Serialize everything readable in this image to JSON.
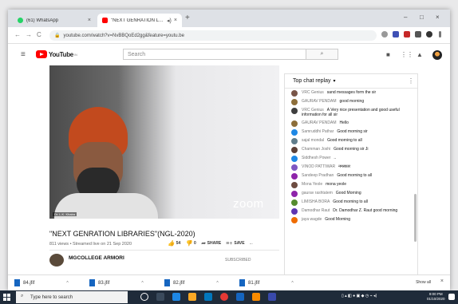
{
  "browser": {
    "tabs": [
      {
        "label": "(61) WhatsApp",
        "favicon_color": "#25d366"
      },
      {
        "label": "\"NEXT GENRATION LIBRARI",
        "favicon_color": "#ff0000"
      }
    ],
    "new_tab": "+",
    "controls": {
      "minimize": "–",
      "maximize": "□",
      "close": "×"
    },
    "back": "←",
    "forward": "→",
    "reload": "C",
    "url": "youtube.com/watch?v=NvBBQoEd2gg&feature=youtu.be"
  },
  "youtube": {
    "logo_text": "YouTube",
    "logo_region": "IN",
    "search_placeholder": "Search",
    "search_icon": "⌕"
  },
  "video": {
    "presenter_caption": "Dr. L.K. Khaira",
    "watermark": "zoom",
    "title": "\"NEXT GENRATION LIBRARIES\"(NGL-2020)",
    "meta": "811 views • Streamed live on 21 Sep 2020",
    "likes": "54",
    "dislikes": "0",
    "share_label": "SHARE",
    "save_label": "SAVE",
    "more": "...",
    "channel_name": "MGCOLLEGE ARMORI",
    "subscribe_label": "SUBSCRIBED"
  },
  "chat": {
    "header": "Top chat replay",
    "header_caret": "▾",
    "more_icon": "⋮",
    "messages": [
      {
        "author": "VRC Genius",
        "text": "sand messages form the sir",
        "color": "#795548"
      },
      {
        "author": "GAURAV PENDAM",
        "text": "good morning",
        "color": "#8d6e3a"
      },
      {
        "author": "VRC Genius",
        "text": "A Very nice presentation and good useful information for all sir",
        "color": "#3e3e3e"
      },
      {
        "author": "GAURAV PENDAM",
        "text": "Hello",
        "color": "#8d6e3a"
      },
      {
        "author": "Samruddhi Pathar",
        "text": "Good morning sir",
        "color": "#1e88e5"
      },
      {
        "author": "sajal mondal",
        "text": "Good morning to all",
        "color": "#607d8b"
      },
      {
        "author": "Chamman Joshi",
        "text": "Good morning sir Ji",
        "color": "#5d4037"
      },
      {
        "author": "Siddhesh Power",
        "text": "..",
        "color": "#1e88e5"
      },
      {
        "author": "VINOD PATTIWAR",
        "text": "नमस्कार",
        "color": "#7e57c2"
      },
      {
        "author": "Sandeep Pradhan",
        "text": "Good morning to all",
        "color": "#8e24aa"
      },
      {
        "author": "Mona Yeole",
        "text": "mona yeole",
        "color": "#6d4c41"
      },
      {
        "author": "gaurav rashtatem",
        "text": "Good Morning",
        "color": "#8e24aa"
      },
      {
        "author": "LIMISHA BORA",
        "text": "Good morning to all",
        "color": "#558b2f"
      },
      {
        "author": "Damodhar Raut",
        "text": "Dr. Damodhar Z. Raut good morning",
        "color": "#5e35b1"
      },
      {
        "author": "jaya wagde",
        "text": "Good Morning",
        "color": "#ef6c00"
      }
    ]
  },
  "downloads": {
    "items": [
      "84.jfif",
      "83.jfif",
      "82.jfif",
      "81.jfif"
    ],
    "caret": "^",
    "show_all": "Show all",
    "close": "×"
  },
  "taskbar": {
    "search_placeholder": "Type here to search",
    "time": "9:00 PM",
    "date": "01/10/2020"
  }
}
